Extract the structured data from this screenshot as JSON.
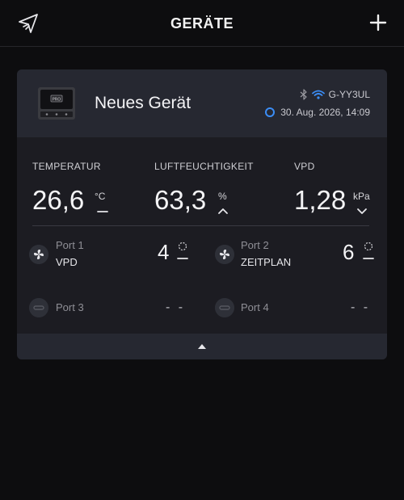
{
  "header": {
    "title": "GERÄTE",
    "logo_icon": "arrow-logo-icon",
    "add_icon": "plus-icon"
  },
  "device": {
    "name": "Neues Gerät",
    "image_label": "PRO",
    "device_id": "G-YY3UL",
    "bluetooth_icon": "bluetooth-icon",
    "wifi_icon": "wifi-icon",
    "timestamp": "30. Aug. 2026, 14:09",
    "accent_color": "#3b8df5"
  },
  "metrics": [
    {
      "label": "TEMPERATUR",
      "value": "26,6",
      "unit": "°C",
      "trend": "flat"
    },
    {
      "label": "LUFTFEUCHTIGKEIT",
      "value": "63,3",
      "unit": "%",
      "trend": "up"
    },
    {
      "label": "VPD",
      "value": "1,28",
      "unit": "kPa",
      "trend": "down"
    }
  ],
  "ports": [
    {
      "label": "Port 1",
      "mode": "VPD",
      "value": "4",
      "icon": "fan-icon",
      "active": true
    },
    {
      "label": "Port 2",
      "mode": "ZEITPLAN",
      "value": "6",
      "icon": "fan-icon",
      "active": true
    },
    {
      "label": "Port 3",
      "mode": "",
      "value": "- -",
      "icon": "plug-icon",
      "active": false
    },
    {
      "label": "Port 4",
      "mode": "",
      "value": "- -",
      "icon": "plug-icon",
      "active": false
    }
  ],
  "footer": {
    "collapse_icon": "triangle-up-icon"
  }
}
